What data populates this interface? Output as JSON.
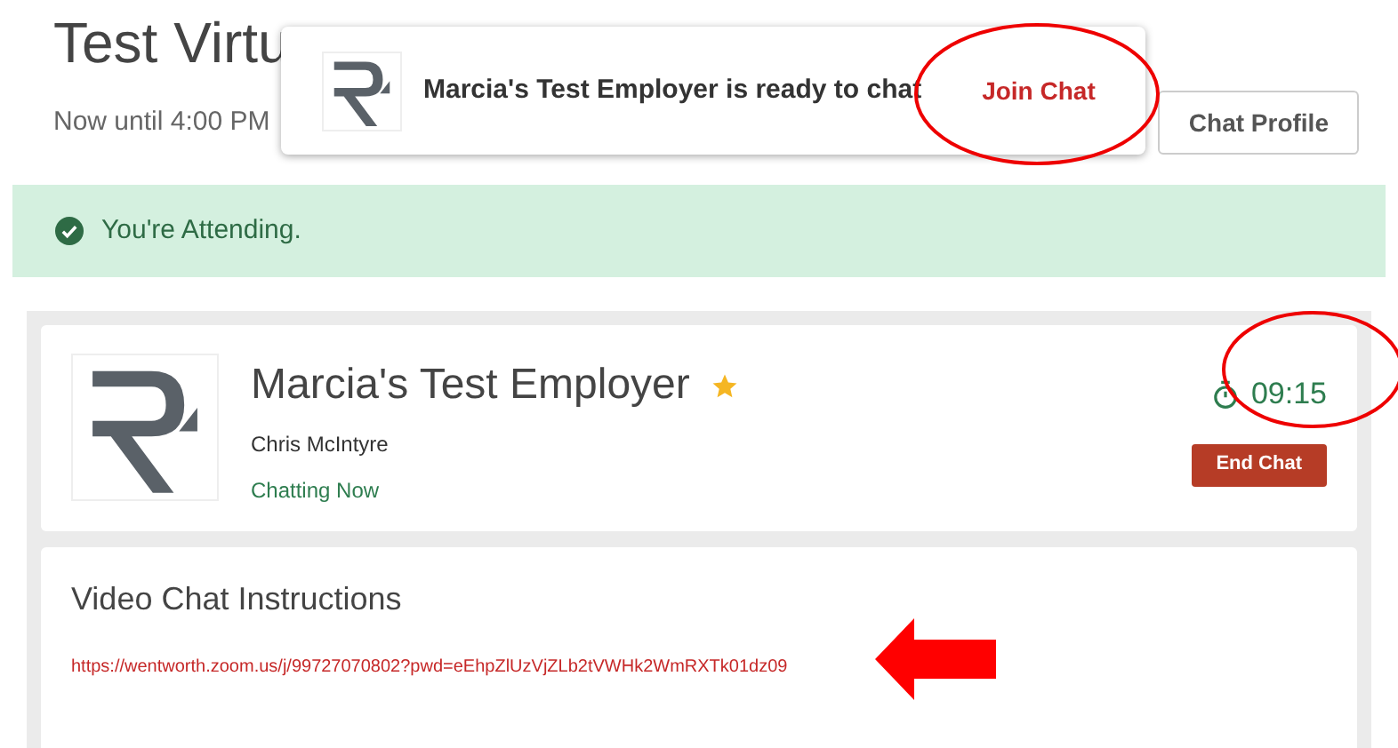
{
  "header": {
    "title": "Test Virtu",
    "subtitle": "Now until 4:00 PM",
    "profile_button": "Chat Profile"
  },
  "notification": {
    "message": "Marcia's Test Employer is ready to chat",
    "action": "Join Chat"
  },
  "banner": {
    "text": "You're Attending."
  },
  "employer": {
    "name": "Marcia's Test Employer",
    "starred": true,
    "contact": "Chris McIntyre",
    "status": "Chatting Now",
    "timer": "09:15",
    "end_button": "End Chat"
  },
  "instructions": {
    "title": "Video Chat Instructions",
    "link": "https://wentworth.zoom.us/j/99727070802?pwd=eEhpZlUzVjZLb2tVWHk2WmRXTk01dz09"
  }
}
